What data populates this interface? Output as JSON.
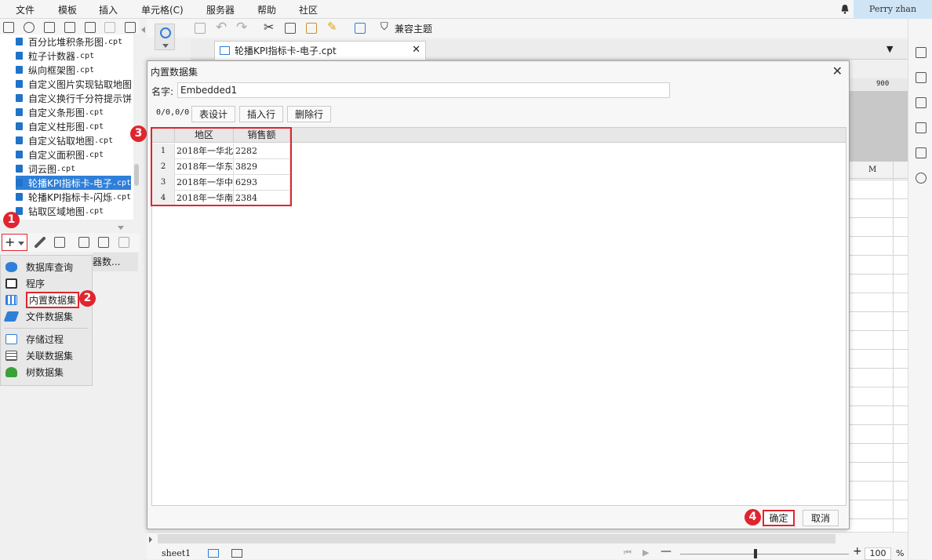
{
  "menubar": {
    "items": [
      "文件",
      "模板",
      "插入",
      "单元格(C)",
      "服务器",
      "帮助",
      "社区"
    ],
    "user": "Perry zhan"
  },
  "file_list": [
    {
      "name": "百分比堆积条形图",
      "ext": ".cpt"
    },
    {
      "name": "粒子计数器",
      "ext": ".cpt"
    },
    {
      "name": "纵向框架图",
      "ext": ".cpt"
    },
    {
      "name": "自定义图片实现钻取地图",
      "ext": ""
    },
    {
      "name": "自定义换行千分符提示饼",
      "ext": ""
    },
    {
      "name": "自定义条形图",
      "ext": ".cpt"
    },
    {
      "name": "自定义柱形图",
      "ext": ".cpt"
    },
    {
      "name": "自定义钻取地图",
      "ext": ".cpt"
    },
    {
      "name": "自定义面积图",
      "ext": ".cpt"
    },
    {
      "name": "词云图",
      "ext": ".cpt"
    },
    {
      "name": "轮播KPI指标卡-电子",
      "ext": ".cpt"
    },
    {
      "name": "轮播KPI指标卡-闪烁",
      "ext": ".cpt"
    },
    {
      "name": "钻取区域地图",
      "ext": ".cpt"
    }
  ],
  "dataset_menu": {
    "items": [
      "数据库查询",
      "程序",
      "内置数据集",
      "文件数据集",
      "存储过程",
      "关联数据集",
      "树数据集"
    ],
    "partial_label": "器数..."
  },
  "toolbar": {
    "theme_label": "兼容主题"
  },
  "tab": {
    "title": "轮播KPI指标卡-电子.cpt"
  },
  "ruler": {
    "mark": "900",
    "column": "M"
  },
  "dialog": {
    "title": "内置数据集",
    "name_label": "名字:",
    "name_value": "Embedded1",
    "counter": "0/0,0/0",
    "buttons": {
      "design": "表设计",
      "insert_row": "插入行",
      "delete_row": "删除行",
      "ok": "确定",
      "cancel": "取消"
    },
    "table": {
      "columns": [
        "地区",
        "销售额"
      ],
      "rows": [
        {
          "n": "1",
          "region": "2018年一华北",
          "sales": "2282"
        },
        {
          "n": "2",
          "region": "2018年一华东",
          "sales": "3829"
        },
        {
          "n": "3",
          "region": "2018年一华中",
          "sales": "6293"
        },
        {
          "n": "4",
          "region": "2018年一华南",
          "sales": "2384"
        }
      ]
    }
  },
  "annotations": [
    "1",
    "2",
    "3",
    "4"
  ],
  "bottom": {
    "sheet": "sheet1",
    "zoom": "100",
    "zoom_suffix": "%",
    "minus": "—",
    "plus": "+"
  },
  "colors": {
    "accent_red": "#e0252f",
    "selection_blue": "#2f7fd8",
    "user_bg": "#cfe5f6"
  }
}
